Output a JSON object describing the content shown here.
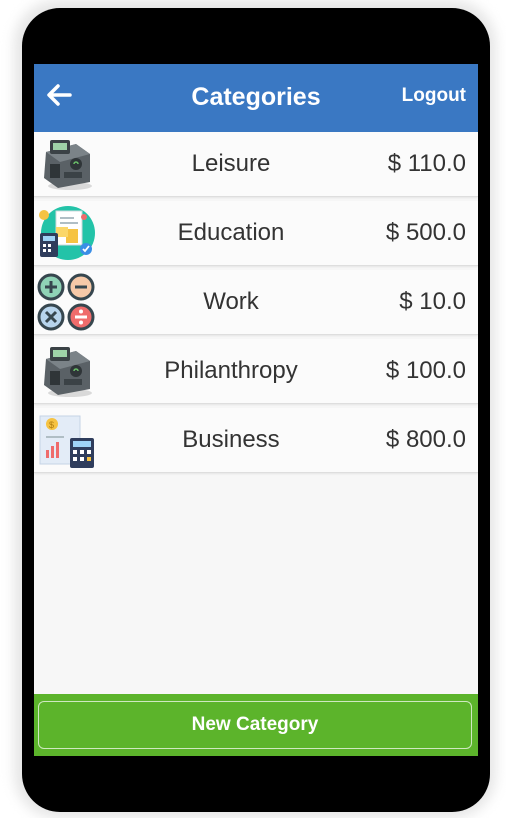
{
  "header": {
    "title": "Categories",
    "logout_label": "Logout",
    "back_icon": "arrow-left-icon"
  },
  "categories": [
    {
      "name": "Leisure",
      "amount": "$ 110.0",
      "icon": "card-terminal-icon"
    },
    {
      "name": "Education",
      "amount": "$ 500.0",
      "icon": "finance-documents-icon"
    },
    {
      "name": "Work",
      "amount": "$ 10.0",
      "icon": "math-operators-icon"
    },
    {
      "name": "Philanthropy",
      "amount": "$ 100.0",
      "icon": "card-terminal-icon"
    },
    {
      "name": "Business",
      "amount": "$ 800.0",
      "icon": "finance-calculator-icon"
    }
  ],
  "footer": {
    "new_category_label": "New Category"
  },
  "colors": {
    "header": "#3a78c3",
    "footer": "#5cb42b"
  }
}
